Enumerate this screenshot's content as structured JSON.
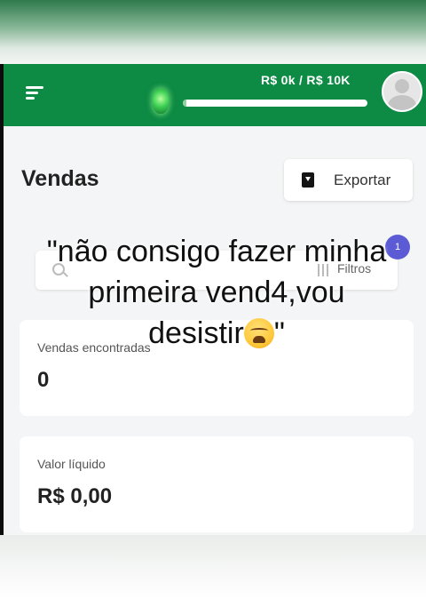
{
  "header": {
    "goal_text": "R$ 0k / R$ 10K",
    "goal_progress": 0.02,
    "colors": {
      "brand": "#0d8a44",
      "progress_fill": "#8ed09f"
    },
    "icons": [
      "menu-icon",
      "gem-icon",
      "avatar"
    ]
  },
  "page": {
    "title": "Vendas",
    "export_label": "Exportar",
    "export_icon": "download-file-icon"
  },
  "search": {
    "filter_label": "Filtros",
    "filter_badge": "1",
    "search_icon": "search-icon",
    "filter_icon": "sliders-icon"
  },
  "cards": [
    {
      "label": "Vendas encontradas",
      "value": "0"
    },
    {
      "label": "Valor líquido",
      "value": "R$ 0,00"
    }
  ],
  "overlay": {
    "line1": "\"não consigo fazer minha",
    "line2": "primeira vend4,vou",
    "line3_text": "desistir",
    "line3_end": "\"",
    "emoji": "weary-face-emoji"
  }
}
